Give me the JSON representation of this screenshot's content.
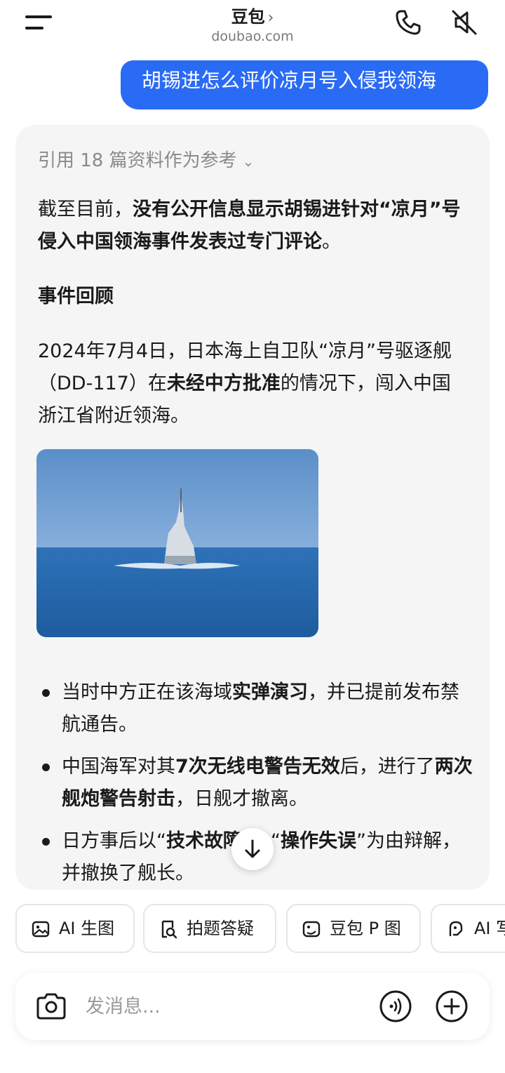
{
  "header": {
    "title": "豆包",
    "title_chevron": "›",
    "domain": "doubao.com"
  },
  "user_message": "胡锡进怎么评价凉月号入侵我领海",
  "answer": {
    "references": "引用 18 篇资料作为参考",
    "references_chevron": "⌄",
    "p1_a": "截至目前，",
    "p1_bold": "没有公开信息显示胡锡进针对“凉月”号侵入中国领海事件发表过专门评论",
    "p1_c": "。",
    "heading": "事件回顾",
    "p2_a": "2024年7月4日，日本海上自卫队“凉月”号驱逐舰（DD-117）在",
    "p2_bold": "未经中方批准",
    "p2_c": "的情况下，闯入中国浙江省附近领海。",
    "bullets": [
      {
        "a": "当时中方正在该海域",
        "b": "实弹演习",
        "c": "，并已提前发布禁航通告。",
        "d": "",
        "e": ""
      },
      {
        "a": "中国海军对其",
        "b": "7次无线电警告无效",
        "c": "后，进行了",
        "d": "两次舰炮警告射击",
        "e": "，日舰才撤离。"
      },
      {
        "a": "日方事后以“",
        "b": "技术故障",
        "c": "”、“",
        "d": "操作失误",
        "e": "”为由辩解，并撤换了舰长。"
      }
    ]
  },
  "chips": [
    {
      "label": "AI 生图",
      "icon": "image-icon"
    },
    {
      "label": "拍题答疑",
      "icon": "search-doc-icon"
    },
    {
      "label": "豆包 P 图",
      "icon": "edit-image-icon"
    },
    {
      "label": "AI 写作",
      "icon": "ai-write-icon"
    }
  ],
  "input": {
    "placeholder": "发消息..."
  },
  "colors": {
    "accent": "#2a6bf6",
    "card_bg": "#f5f5f5"
  }
}
